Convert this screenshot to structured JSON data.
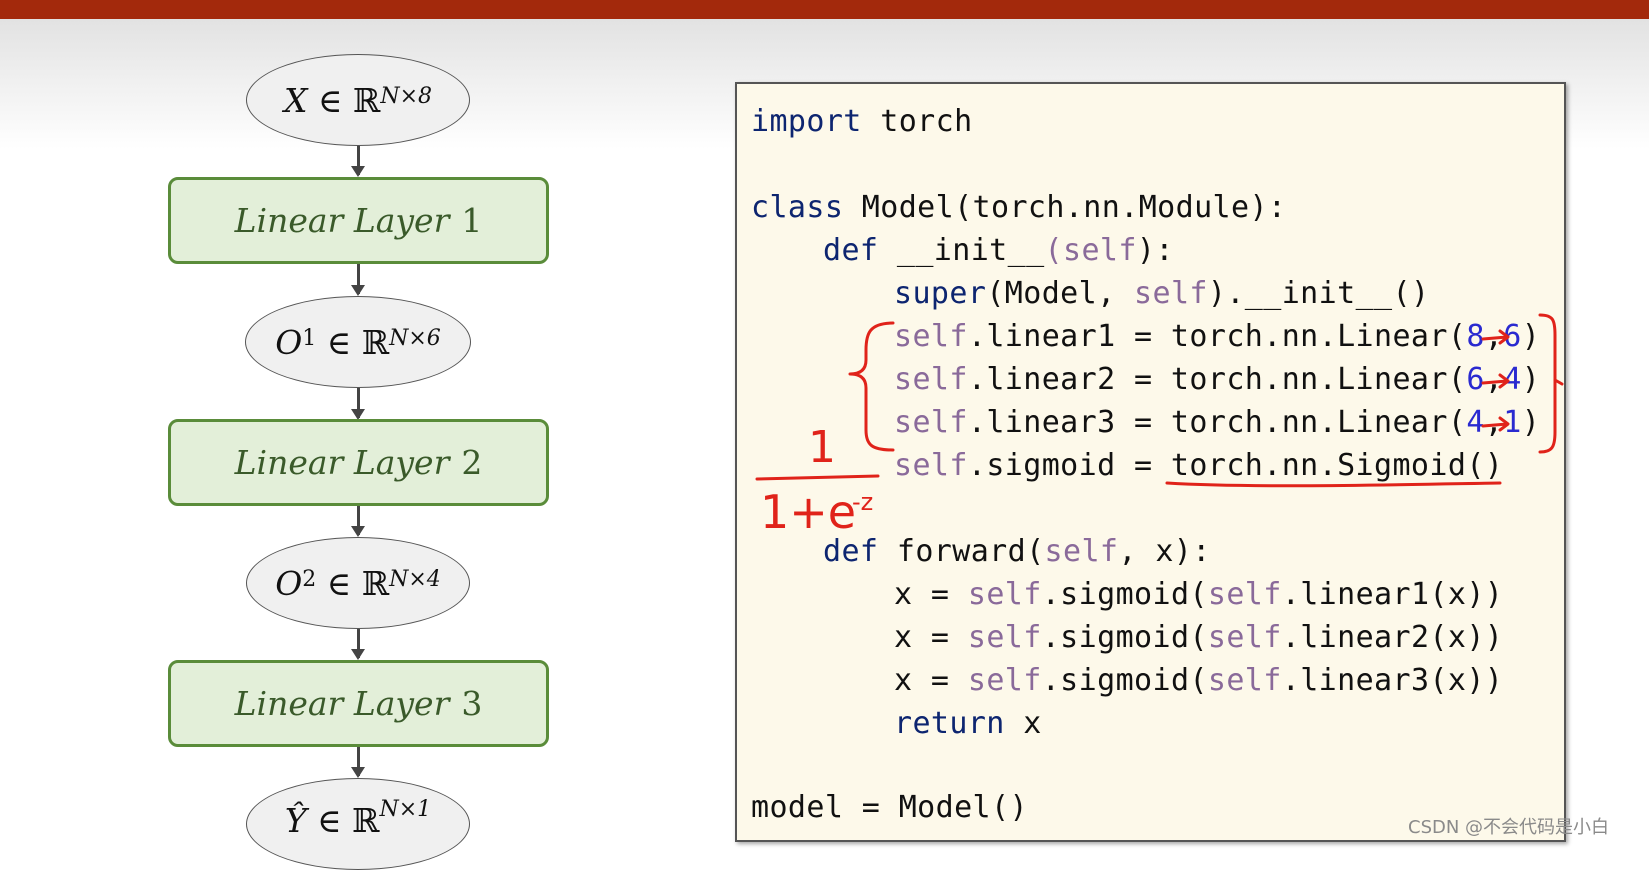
{
  "flowchart": {
    "input_node": {
      "var": "X",
      "set": "ℝ",
      "dims": "N×8"
    },
    "layer1": {
      "italic": "Linear Layer",
      "num": "1"
    },
    "o1_node": {
      "var": "O",
      "sup": "1",
      "set": "ℝ",
      "dims": "N×6"
    },
    "layer2": {
      "italic": "Linear Layer",
      "num": "2"
    },
    "o2_node": {
      "var": "O",
      "sup": "2",
      "set": "ℝ",
      "dims": "N×4"
    },
    "layer3": {
      "italic": "Linear Layer",
      "num": "3"
    },
    "output_node": {
      "var": "Ŷ",
      "set": "ℝ",
      "dims": "N×1"
    },
    "elem_symbol": "∈"
  },
  "code": {
    "l1": {
      "a": "import",
      "b": " torch"
    },
    "l2": {
      "a": "class",
      "b": " Model(torch.nn.Module):"
    },
    "l3": {
      "a": "def",
      "b": " __init__",
      "c": "(self",
      "d": "):"
    },
    "l4": {
      "a": "super",
      "b": "(Model, ",
      "c": "self",
      "d": ").__init__()"
    },
    "l5": {
      "self": "self",
      "rest": ".linear1 = torch.nn.Linear(",
      "n1": "8",
      "sep": ",",
      "n2": "6",
      "end": ")"
    },
    "l6": {
      "self": "self",
      "rest": ".linear2 = torch.nn.Linear(",
      "n1": "6",
      "sep": ",",
      "n2": "4",
      "end": ")"
    },
    "l7": {
      "self": "self",
      "rest": ".linear3 = torch.nn.Linear(",
      "n1": "4",
      "sep": ",",
      "n2": "1",
      "end": ")"
    },
    "l8": {
      "self": "self",
      "rest": ".sigmoid = torch.nn.Sigmoid()"
    },
    "l9": {
      "a": "def",
      "b": " forward(",
      "c": "self",
      "d": ", x):"
    },
    "l10": {
      "a": "x = ",
      "s1": "self",
      "b": ".sigmoid(",
      "s2": "self",
      "c": ".linear1(x))"
    },
    "l11": {
      "a": "x = ",
      "s1": "self",
      "b": ".sigmoid(",
      "s2": "self",
      "c": ".linear2(x))"
    },
    "l12": {
      "a": "x = ",
      "s1": "self",
      "b": ".sigmoid(",
      "s2": "self",
      "c": ".linear3(x))"
    },
    "l13": {
      "a": "return",
      "b": " x"
    },
    "l14": {
      "a": "model = Model()"
    }
  },
  "annotation": {
    "numerator": "1",
    "denominator": "1+e",
    "exponent": "-z",
    "color": "#e0231a"
  },
  "watermark": "CSDN @不会代码是小白"
}
